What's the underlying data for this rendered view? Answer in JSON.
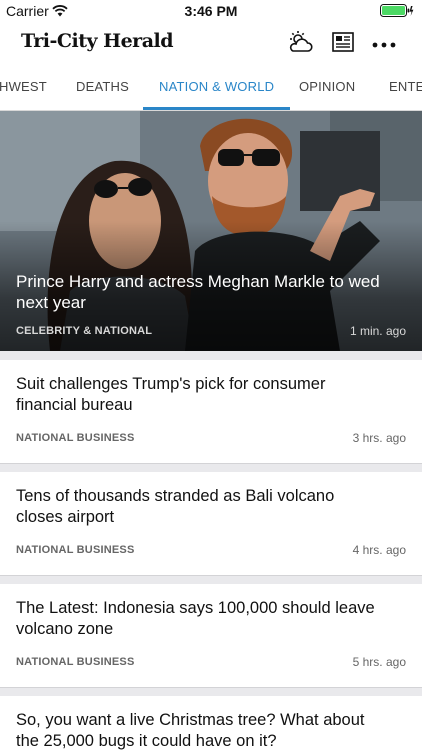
{
  "status_bar": {
    "carrier": "Carrier",
    "time": "3:46 PM"
  },
  "header": {
    "logo": "Tri-City Herald",
    "icons": [
      "weather-icon",
      "newspaper-icon",
      "more-icon"
    ]
  },
  "tabs": [
    {
      "label": "HWEST"
    },
    {
      "label": "DEATHS"
    },
    {
      "label": "NATION & WORLD",
      "active": true
    },
    {
      "label": "OPINION"
    },
    {
      "label": "ENTER"
    }
  ],
  "hero": {
    "title": "Prince Harry and actress Meghan Markle to wed next year",
    "category": "CELEBRITY & NATIONAL",
    "time": "1 min. ago"
  },
  "articles": [
    {
      "title": "Suit challenges Trump's pick for consumer financial bureau",
      "category": "NATIONAL BUSINESS",
      "time": "3 hrs. ago"
    },
    {
      "title": "Tens of thousands stranded as Bali volcano closes airport",
      "category": "NATIONAL BUSINESS",
      "time": "4 hrs. ago"
    },
    {
      "title": "The Latest: Indonesia says 100,000 should leave volcano zone",
      "category": "NATIONAL BUSINESS",
      "time": "5 hrs. ago"
    },
    {
      "title": "So, you want a live Christmas tree? What about the 25,000 bugs it could have on it?",
      "category": "",
      "time": ""
    }
  ],
  "colors": {
    "accent": "#2a86c8",
    "battery": "#4cd964"
  }
}
